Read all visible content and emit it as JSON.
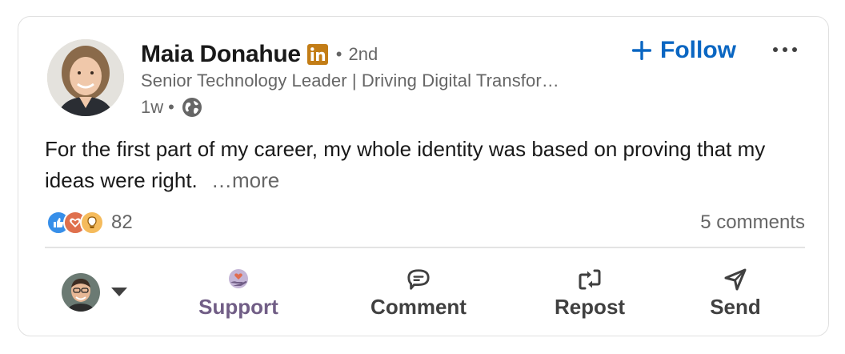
{
  "post": {
    "author": {
      "name": "Maia Donahue",
      "connection_degree": "2nd",
      "separator": "•",
      "headline": "Senior Technology Leader | Driving Digital Transfor…",
      "time_ago": "1w",
      "time_separator": "•",
      "badge_icon": "linkedin-badge-icon",
      "visibility_icon": "globe-icon"
    },
    "follow_label": "Follow",
    "more_menu_icon": "ellipsis-icon",
    "text": "For the first part of my career, my whole identity was based on proving that my ideas were right.",
    "see_more_label": "…more",
    "reactions": {
      "icons": [
        "like-reaction-icon",
        "love-reaction-icon",
        "insightful-reaction-icon"
      ],
      "count": "82"
    },
    "comments_label": "5 comments"
  },
  "actions": {
    "support_label": "Support",
    "comment_label": "Comment",
    "repost_label": "Repost",
    "send_label": "Send"
  },
  "colors": {
    "link_blue": "#0a66c2",
    "support_purple": "#715e86",
    "secondary_text": "#666666",
    "primary_text": "#191919"
  }
}
